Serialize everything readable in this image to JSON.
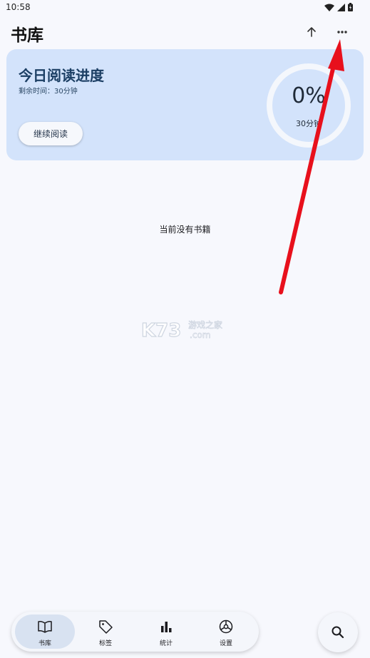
{
  "status_bar": {
    "time": "10:58",
    "icons": [
      "wifi-icon",
      "signal-icon",
      "battery-icon"
    ]
  },
  "app_bar": {
    "title": "书库",
    "actions": [
      "upload-icon",
      "more-icon"
    ]
  },
  "reading_card": {
    "title": "今日阅读进度",
    "remaining": "剩余时间：30分钟",
    "continue_label": "继续阅读",
    "percent_text": "0%",
    "progress": 0,
    "goal_text": "30分钟"
  },
  "empty_state": {
    "message": "当前没有书籍"
  },
  "watermark": {
    "brand": "K73",
    "tagline": "游戏之家",
    "domain": ".com"
  },
  "bottom_nav": {
    "items": [
      {
        "label": "书库",
        "icon": "book-icon",
        "active": true
      },
      {
        "label": "标签",
        "icon": "tag-icon",
        "active": false
      },
      {
        "label": "统计",
        "icon": "bar-chart-icon",
        "active": false
      },
      {
        "label": "设置",
        "icon": "settings-icon",
        "active": false
      }
    ]
  },
  "fab": {
    "icon": "search-icon"
  },
  "colors": {
    "background": "#f7f8fd",
    "card": "#d3e3fb",
    "card_title": "#1c3f64",
    "ring": "#f4f7fc",
    "annotation_arrow": "#e8101c",
    "nav_active": "#d8e2f1"
  }
}
